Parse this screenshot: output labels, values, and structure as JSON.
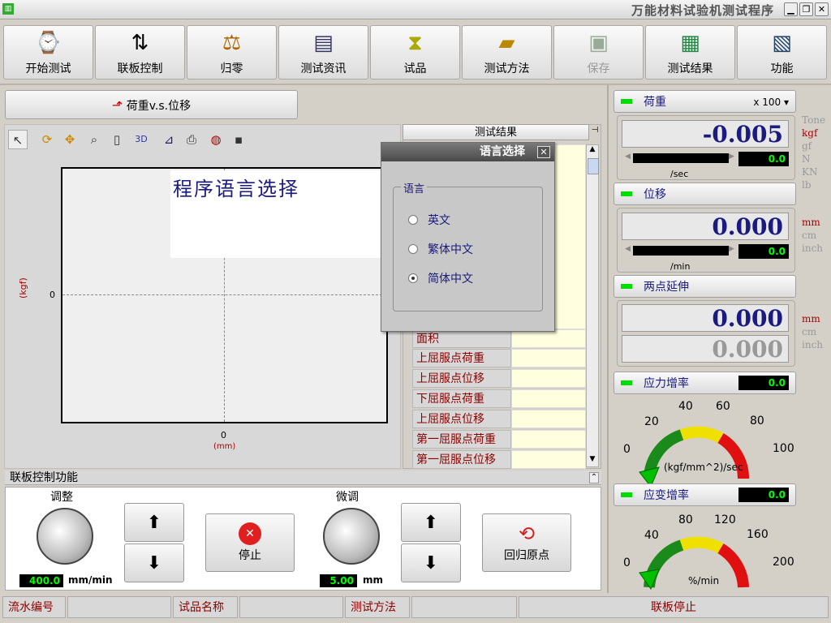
{
  "app": {
    "title": "万能材料试验机测试程序"
  },
  "toolbar": [
    {
      "label": "开始测试",
      "icon": "start-test-icon"
    },
    {
      "label": "联板控制",
      "icon": "panel-control-icon"
    },
    {
      "label": "归零",
      "icon": "balance-zero-icon"
    },
    {
      "label": "测试资讯",
      "icon": "test-info-icon"
    },
    {
      "label": "试品",
      "icon": "specimen-icon"
    },
    {
      "label": "测试方法",
      "icon": "test-method-icon"
    },
    {
      "label": "保存",
      "icon": "save-icon"
    },
    {
      "label": "测试结果",
      "icon": "test-results-icon"
    },
    {
      "label": "功能",
      "icon": "function-icon"
    }
  ],
  "chart": {
    "tab_label": "荷重v.s.位移",
    "title": "程序语言选择",
    "ylabel": "(kgf)",
    "xlabel": "(mm)",
    "y_zero": "0",
    "x_zero": "0",
    "threed_label": "3D"
  },
  "results": {
    "header": "测试结果",
    "rows": [
      "面积",
      "上屈服点荷重",
      "上屈服点位移",
      "下屈服点荷重",
      "上屈服点位移",
      "第一屈服点荷重",
      "第一屈服点位移"
    ]
  },
  "dialog": {
    "title": "语言选择",
    "group_label": "语言",
    "options": [
      "英文",
      "繁体中文",
      "简体中文"
    ],
    "selected": 2
  },
  "load": {
    "label": "荷重",
    "scale": "x 100",
    "value": "-0.005",
    "rate": "0.0",
    "rate_unit": "/sec",
    "units": [
      "Tone",
      "kgf",
      "gf",
      "N",
      "KN",
      "lb"
    ]
  },
  "disp": {
    "label": "位移",
    "value": "0.000",
    "rate": "0.0",
    "rate_unit": "/min",
    "units": [
      "mm",
      "cm",
      "inch"
    ]
  },
  "ext": {
    "label": "两点延伸",
    "value1": "0.000",
    "value2": "0.000",
    "units": [
      "mm",
      "cm",
      "inch"
    ]
  },
  "stress_rate": {
    "label": "应力增率",
    "value": "0.0",
    "ticks": [
      "0",
      "20",
      "40",
      "60",
      "80",
      "100"
    ],
    "unit": "(kgf/mm^2)/sec"
  },
  "strain_rate": {
    "label": "应变增率",
    "value": "0.0",
    "ticks": [
      "0",
      "40",
      "80",
      "120",
      "160",
      "200"
    ],
    "unit": "%/min"
  },
  "control": {
    "header": "联板控制功能",
    "adjust_label": "调整",
    "adjust_value": "400.0",
    "adjust_unit": "mm/min",
    "fine_label": "微调",
    "fine_value": "5.00",
    "fine_unit": "mm",
    "stop_label": "停止",
    "home_label": "回归原点"
  },
  "status": [
    "流水编号",
    "",
    "试品名称",
    "",
    "测试方法",
    "",
    "联板停止"
  ]
}
